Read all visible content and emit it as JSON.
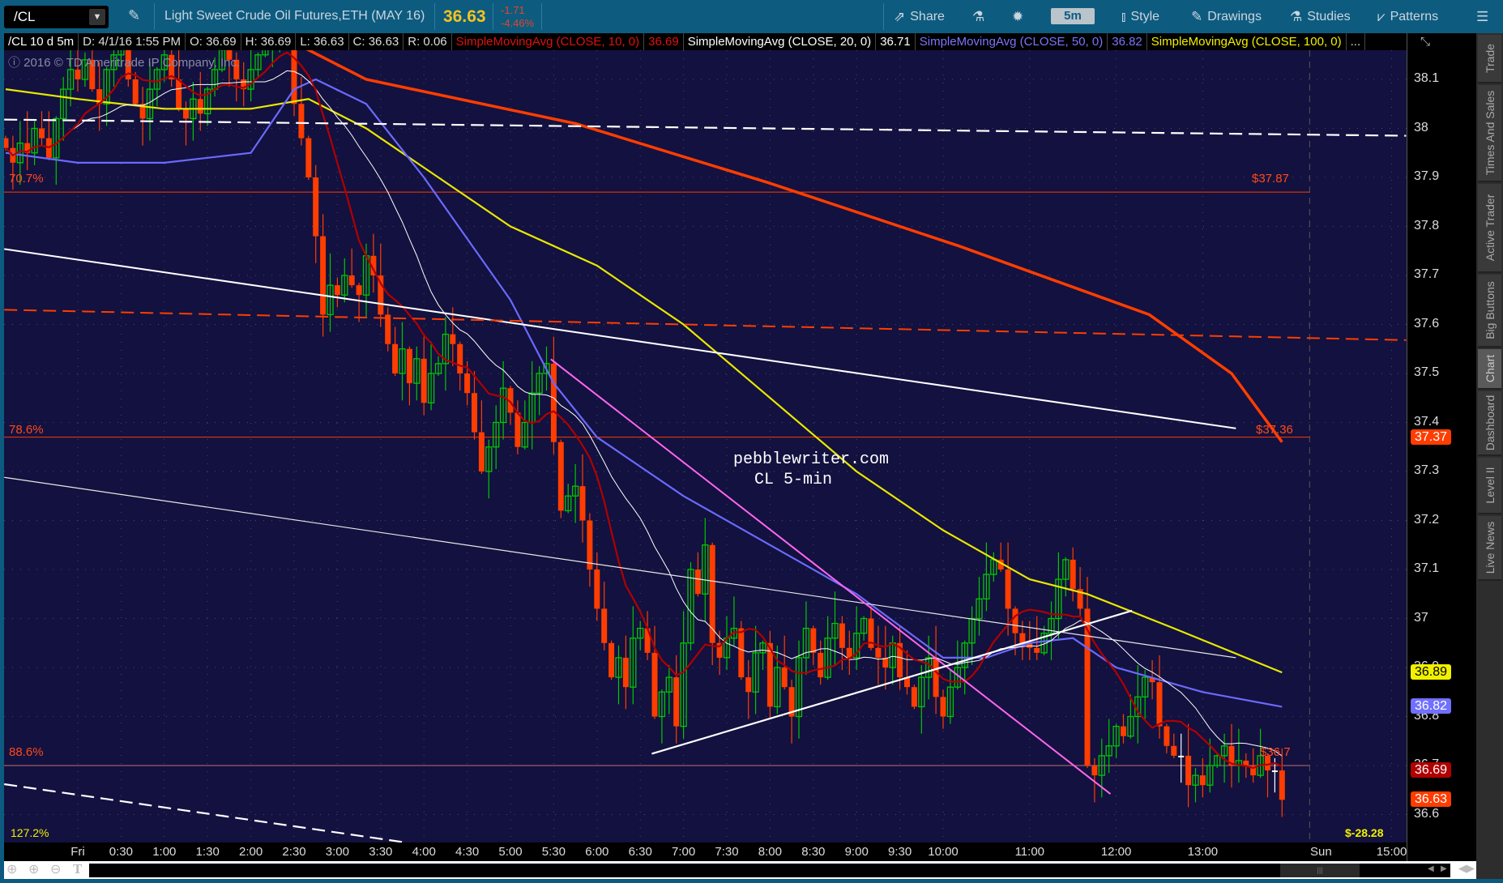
{
  "toolbar": {
    "symbol": "/CL",
    "description": "Light Sweet Crude Oil Futures,ETH (MAY 16)",
    "last": "36.63",
    "change": "-1.71",
    "change_pct": "-4.46%",
    "share": "Share",
    "timeframe": "5m",
    "style": "Style",
    "drawings": "Drawings",
    "studies": "Studies",
    "patterns": "Patterns"
  },
  "info": {
    "chart": "/CL 10 d 5m",
    "date": "D: 4/1/16 1:55 PM",
    "open": "O: 36.69",
    "high": "H: 36.69",
    "low": "L: 36.63",
    "close": "C: 36.63",
    "range": "R: 0.06",
    "studies": [
      {
        "label": "SimpleMovingAvg (CLOSE, 10, 0)",
        "value": "36.69",
        "color": "#e01010"
      },
      {
        "label": "SimpleMovingAvg (CLOSE, 20, 0)",
        "value": "36.71",
        "color": "#ffffff"
      },
      {
        "label": "SimpleMovingAvg (CLOSE, 50, 0)",
        "value": "36.82",
        "color": "#7b73ff"
      },
      {
        "label": "SimpleMovingAvg (CLOSE, 100, 0)",
        "value": "",
        "color": "#f0f000"
      }
    ],
    "more": "..."
  },
  "copyright": "2016 © TD Ameritrade IP Company, Inc.",
  "watermark": {
    "line1": "pebblewriter.com",
    "line2": "CL 5-min"
  },
  "fib_labels": {
    "f707": "70.7%",
    "f786": "78.6%",
    "f886": "88.6%",
    "f1272": "127.2%",
    "p3787": "$37.87",
    "p3736": "$37.36",
    "p367": "$36.7",
    "bottom": "$-28.28"
  },
  "price_badges": [
    {
      "value": "37.37",
      "color": "#ff3d00",
      "text": "#fff"
    },
    {
      "value": "36.89",
      "color": "#f0f000",
      "text": "#000"
    },
    {
      "value": "36.82",
      "color": "#7070ff",
      "text": "#fff"
    },
    {
      "value": "36.69",
      "color": "#b00000",
      "text": "#fff"
    },
    {
      "value": "36.63",
      "color": "#ff3d00",
      "text": "#fff"
    }
  ],
  "side_tabs": [
    "Trade",
    "Times And Sales",
    "Active Trader",
    "Big Buttons",
    "Chart",
    "Dashboard",
    "Level II",
    "Live News"
  ],
  "colors": {
    "up": "#00c800",
    "down": "#ff3d00",
    "sma10": "#b00000",
    "sma20": "#ffffff",
    "sma50": "#6a6aff",
    "sma100": "#e8e800",
    "trend": "#ff3d00"
  },
  "chart_data": {
    "type": "candlestick",
    "title": "/CL 10 d 5m",
    "ylim": [
      36.54,
      38.16
    ],
    "yticks": [
      38.1,
      38,
      37.9,
      37.8,
      37.7,
      37.6,
      37.5,
      37.4,
      37.3,
      37.2,
      37.1,
      37,
      36.9,
      36.8,
      36.7,
      36.6
    ],
    "ytick_labels": [
      "38.1",
      "38",
      "37.9",
      "37.8",
      "37.7",
      "37.6",
      "37.5",
      "37.4",
      "37.3",
      "37.2",
      "37.1",
      "37",
      "36.9",
      "36.8",
      "36.7",
      "36.6"
    ],
    "xticks": [
      {
        "label": "Fri",
        "t": 0
      },
      {
        "label": "0:30",
        "t": 30
      },
      {
        "label": "1:00",
        "t": 60
      },
      {
        "label": "1:30",
        "t": 90
      },
      {
        "label": "2:00",
        "t": 120
      },
      {
        "label": "2:30",
        "t": 150
      },
      {
        "label": "3:00",
        "t": 180
      },
      {
        "label": "3:30",
        "t": 210
      },
      {
        "label": "4:00",
        "t": 240
      },
      {
        "label": "4:30",
        "t": 270
      },
      {
        "label": "5:00",
        "t": 300
      },
      {
        "label": "5:30",
        "t": 330
      },
      {
        "label": "6:00",
        "t": 360
      },
      {
        "label": "6:30",
        "t": 390
      },
      {
        "label": "7:00",
        "t": 420
      },
      {
        "label": "7:30",
        "t": 450
      },
      {
        "label": "8:00",
        "t": 480
      },
      {
        "label": "8:30",
        "t": 510
      },
      {
        "label": "9:00",
        "t": 540
      },
      {
        "label": "9:30",
        "t": 570
      },
      {
        "label": "10:00",
        "t": 600
      },
      {
        "label": "11:00",
        "t": 660
      },
      {
        "label": "12:00",
        "t": 720
      },
      {
        "label": "13:00",
        "t": 780
      },
      {
        "label": "Sun",
        "t": 862
      },
      {
        "label": "15:00",
        "t": 911
      }
    ],
    "candle_start_minute": -50,
    "candle_interval_minutes": 5,
    "closes": [
      37.96,
      37.93,
      37.97,
      37.95,
      38.0,
      37.98,
      37.94,
      38.02,
      38.08,
      38.12,
      38.1,
      38.14,
      38.08,
      38.05,
      38.12,
      38.15,
      38.18,
      38.1,
      38.05,
      38.02,
      38.08,
      38.12,
      38.15,
      38.1,
      38.04,
      38.02,
      38.06,
      38.03,
      38.08,
      38.12,
      38.16,
      38.14,
      38.1,
      38.08,
      38.12,
      38.15,
      38.18,
      38.2,
      38.22,
      38.2,
      38.05,
      37.98,
      37.9,
      37.78,
      37.62,
      37.68,
      37.66,
      37.7,
      37.68,
      37.66,
      37.74,
      37.7,
      37.62,
      37.56,
      37.5,
      37.55,
      37.48,
      37.53,
      37.44,
      37.5,
      37.52,
      37.58,
      37.56,
      37.5,
      37.46,
      37.38,
      37.3,
      37.35,
      37.4,
      37.47,
      37.42,
      37.35,
      37.4,
      37.46,
      37.5,
      37.52,
      37.36,
      37.22,
      37.25,
      37.27,
      37.2,
      37.1,
      37.02,
      36.95,
      36.88,
      36.92,
      36.86,
      36.96,
      36.98,
      36.93,
      36.8,
      36.85,
      36.88,
      36.78,
      36.95,
      37.1,
      37.05,
      37.15,
      36.95,
      36.92,
      36.96,
      36.98,
      36.88,
      36.85,
      36.93,
      36.95,
      36.82,
      36.9,
      36.86,
      36.8,
      36.92,
      36.98,
      36.93,
      36.88,
      36.96,
      36.99,
      36.94,
      36.92,
      36.97,
      37.0,
      36.94,
      36.92,
      36.9,
      36.95,
      36.88,
      36.86,
      36.82,
      36.88,
      36.92,
      36.84,
      36.8,
      36.86,
      36.9,
      36.95,
      37.0,
      37.04,
      37.09,
      37.12,
      37.1,
      37.02,
      36.97,
      36.95,
      36.94,
      36.93,
      36.97,
      37.0,
      37.08,
      37.12,
      37.06,
      37.02,
      36.7,
      36.68,
      36.72,
      36.74,
      36.78,
      36.76,
      36.8,
      36.84,
      36.88,
      36.87,
      36.78,
      36.74,
      36.72,
      36.72,
      36.66,
      36.68,
      36.66,
      36.7,
      36.72,
      36.74,
      36.7,
      36.71,
      36.7,
      36.68,
      36.72,
      36.69,
      36.69,
      36.63
    ],
    "sma50_points": [
      [
        -50,
        37.95
      ],
      [
        0,
        37.93
      ],
      [
        60,
        37.93
      ],
      [
        120,
        37.95
      ],
      [
        150,
        38.08
      ],
      [
        165,
        38.1
      ],
      [
        200,
        38.05
      ],
      [
        240,
        37.9
      ],
      [
        300,
        37.65
      ],
      [
        330,
        37.48
      ],
      [
        360,
        37.37
      ],
      [
        420,
        37.25
      ],
      [
        480,
        37.15
      ],
      [
        540,
        37.05
      ],
      [
        600,
        36.92
      ],
      [
        630,
        36.92
      ],
      [
        660,
        36.95
      ],
      [
        690,
        36.96
      ],
      [
        720,
        36.9
      ],
      [
        780,
        36.85
      ],
      [
        835,
        36.82
      ]
    ],
    "sma100_points": [
      [
        -50,
        38.08
      ],
      [
        0,
        38.06
      ],
      [
        60,
        38.04
      ],
      [
        120,
        38.04
      ],
      [
        160,
        38.06
      ],
      [
        200,
        38.0
      ],
      [
        240,
        37.92
      ],
      [
        300,
        37.8
      ],
      [
        360,
        37.72
      ],
      [
        420,
        37.6
      ],
      [
        480,
        37.45
      ],
      [
        540,
        37.3
      ],
      [
        600,
        37.18
      ],
      [
        660,
        37.08
      ],
      [
        700,
        37.05
      ],
      [
        760,
        36.98
      ],
      [
        835,
        36.89
      ]
    ],
    "trend_points": [
      [
        120,
        38.22
      ],
      [
        200,
        38.1
      ],
      [
        345,
        38.01
      ],
      [
        478,
        37.89
      ],
      [
        611,
        37.76
      ],
      [
        743,
        37.62
      ],
      [
        800,
        37.5
      ],
      [
        835,
        37.36
      ]
    ],
    "fib_levels": [
      {
        "label": "70.7%",
        "price": 37.87
      },
      {
        "label": "78.6%",
        "price": 37.37
      },
      {
        "label": "88.6%",
        "price": 36.7
      }
    ],
    "drawn_lines": [
      {
        "name": "white-dashed-top",
        "from": [
          -51,
          38.018
        ],
        "to": [
          921,
          37.985
        ],
        "color": "#ffffff",
        "dash": true,
        "width": 2.2
      },
      {
        "name": "white-resistance",
        "from": [
          -51,
          37.754
        ],
        "to": [
          803,
          37.388
        ],
        "color": "#ffffff",
        "dash": false,
        "width": 2
      },
      {
        "name": "orange-dashed",
        "from": [
          -51,
          37.63
        ],
        "to": [
          921,
          37.568
        ],
        "color": "#ff3d00",
        "dash": true,
        "width": 2
      },
      {
        "name": "white-thin-channel",
        "from": [
          -51,
          37.288
        ],
        "to": [
          803,
          36.92
        ],
        "color": "#e8e8e8",
        "dash": false,
        "width": 1.2
      },
      {
        "name": "pink-downtrend",
        "from": [
          328,
          37.529
        ],
        "to": [
          716,
          36.642
        ],
        "color": "#ff66ee",
        "dash": false,
        "width": 2
      },
      {
        "name": "white-uptrend",
        "from": [
          398,
          36.724
        ],
        "to": [
          731,
          37.016
        ],
        "color": "#ffffff",
        "dash": false,
        "width": 2.2
      },
      {
        "name": "white-dashed-bottom",
        "from": [
          -51,
          36.662
        ],
        "to": [
          225,
          36.544
        ],
        "color": "#ffffff",
        "dash": true,
        "width": 2.2
      }
    ]
  }
}
